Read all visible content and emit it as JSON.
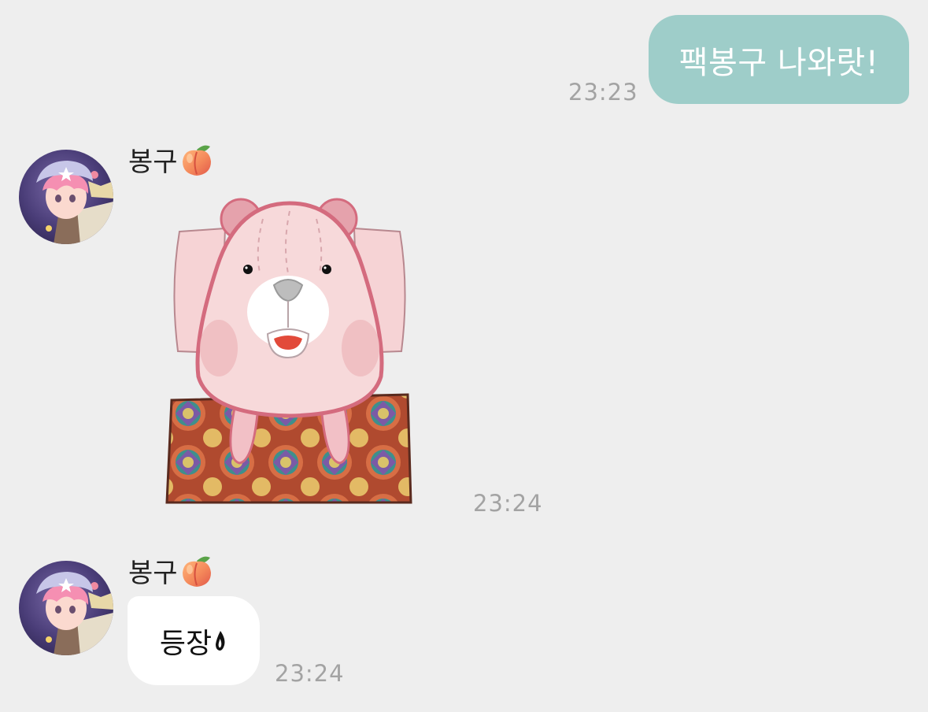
{
  "messages": {
    "outgoing": {
      "text": "팩봉구 나와랏!",
      "time": "23:23"
    },
    "sticker": {
      "sender": "봉구",
      "time": "23:24"
    },
    "incoming": {
      "sender": "봉구",
      "text": "등장",
      "time": "23:24"
    }
  },
  "icons": {
    "peach": "peach-emoji-icon",
    "flame": "candle-flame-icon",
    "sticker": "pink-bear-on-carpet-sticker",
    "avatar": "pink-haired-character-avatar"
  },
  "colors": {
    "background": "#eeeeee",
    "outgoing_bubble": "#9ecdc9",
    "incoming_bubble": "#ffffff",
    "timestamp": "#a3a3a3"
  }
}
